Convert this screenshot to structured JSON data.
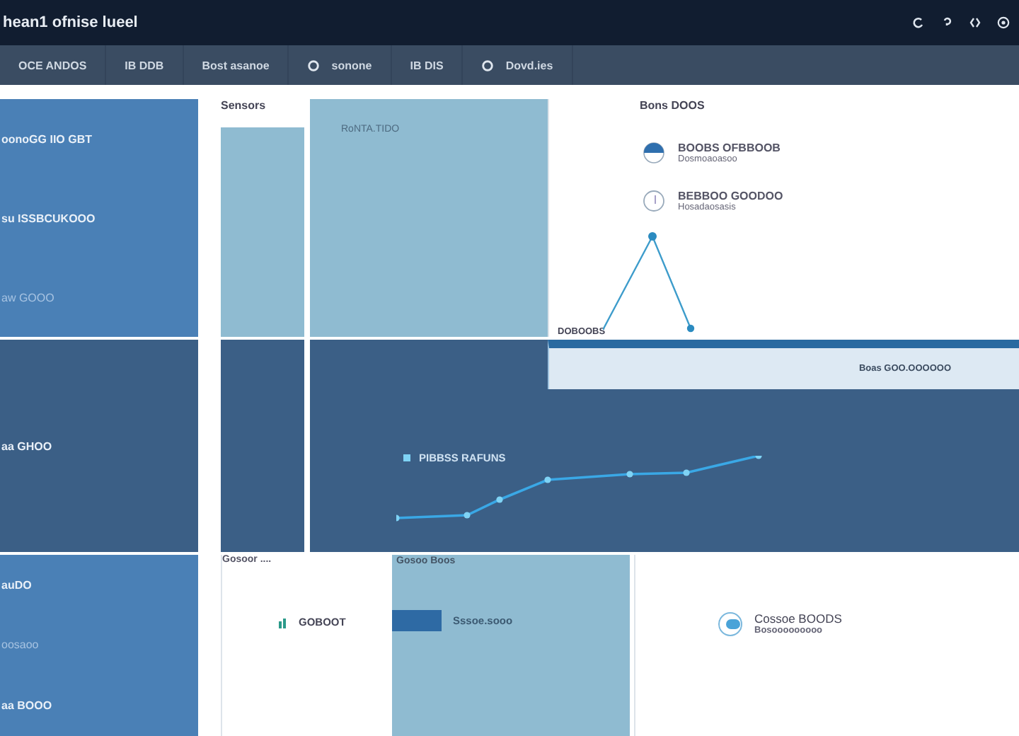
{
  "window": {
    "title": "hean1 ofnise lueel"
  },
  "toolbar": [
    {
      "label": "OCE ANDOS",
      "icon": false
    },
    {
      "label": "IB DDB",
      "icon": false
    },
    {
      "label": "Bost asanoe",
      "icon": false
    },
    {
      "label": "sonone",
      "icon": true
    },
    {
      "label": "IB DIS",
      "icon": false
    },
    {
      "label": "Dovd.ies",
      "icon": true
    }
  ],
  "left_tiles": [
    {
      "lines": [
        {
          "text": "oonoGG IIO GBT",
          "muted": false
        },
        {
          "text": "su ISSBCUKOOO",
          "muted": false
        },
        {
          "text": "aw GOOO",
          "muted": true
        }
      ]
    },
    {
      "lines": [
        {
          "text": "aa GHOO",
          "muted": false
        }
      ]
    },
    {
      "lines": [
        {
          "text": "auDO",
          "muted": false
        },
        {
          "text": "oosaoo",
          "muted": true
        },
        {
          "text": "aa BOOO",
          "muted": false
        }
      ]
    }
  ],
  "top_row": {
    "heading": "Sensors",
    "panel_label": "RoNTA.TIDO",
    "chart_title": "Bons DOOS",
    "legend": [
      {
        "name": "BOOBS OFBBOOB",
        "detail": "Dosmoaoasoo",
        "kind": "half"
      },
      {
        "name": "BEBBOO GOODOO",
        "detail": "Hosadaosasis",
        "kind": "ring"
      }
    ],
    "axis_label": "DOBOOBS"
  },
  "middle_row": {
    "band_text": "Boas GOO.OOOOOO",
    "legend": "PIBBSS RAFUNS"
  },
  "bottom_row": {
    "heading": "Gosoor ....",
    "item": "GOBOOT",
    "panel_label": "Gosoo Boos",
    "bar_label": "Sssoe.sooo",
    "status_name": "Cossoe BOODS",
    "status_detail": "Bosooooooooo"
  }
}
